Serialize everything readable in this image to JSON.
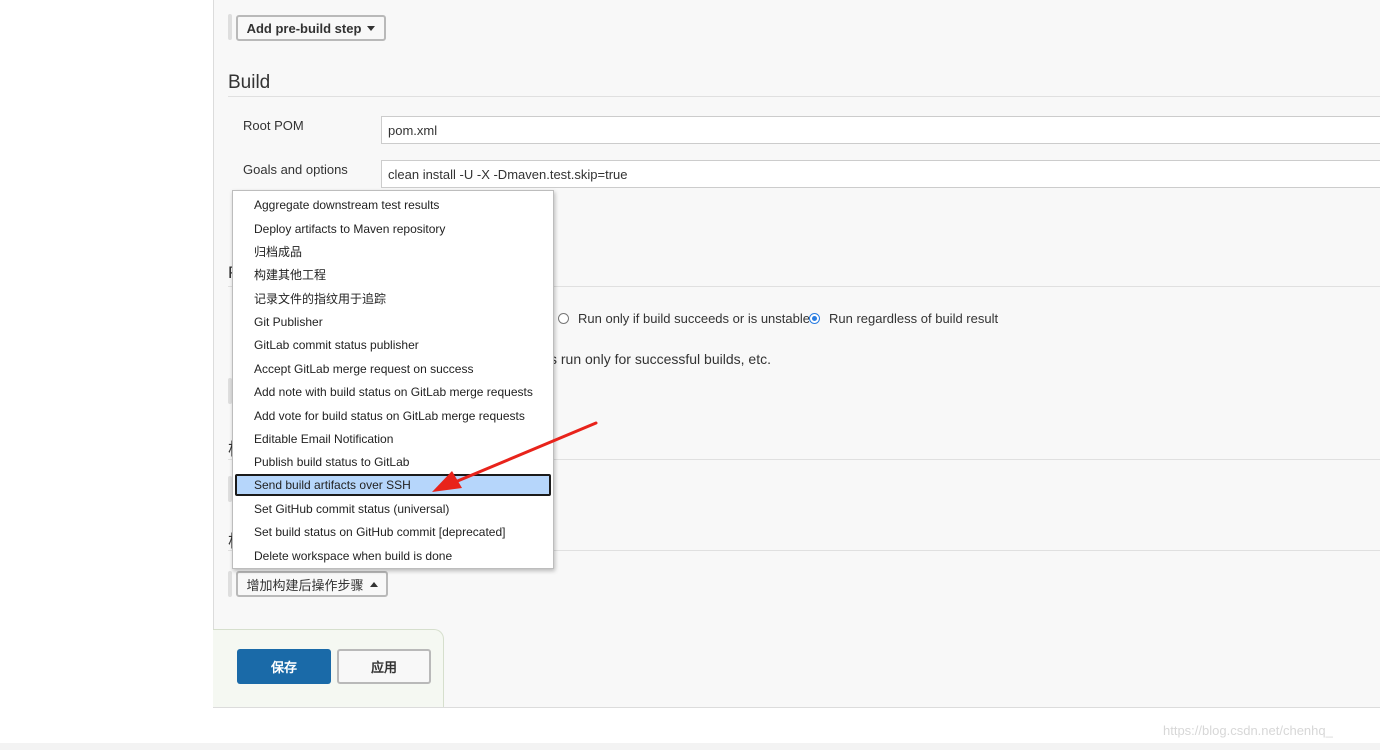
{
  "pre_build": {
    "add_button_label": "Add pre-build step"
  },
  "build": {
    "heading": "Build",
    "root_pom_label": "Root POM",
    "root_pom_value": "pom.xml",
    "goals_label": "Goals and options",
    "goals_value": "clean install -U -X -Dmaven.test.skip=true"
  },
  "post_steps": {
    "heading_fragment": "P",
    "radio_options": [
      {
        "label": "Run only if build succeeds or is unstable",
        "checked": false
      },
      {
        "label": "Run regardless of build result",
        "checked": true
      }
    ],
    "help_fragment": "s run only for successful builds, etc.",
    "section2_fragment": "构",
    "section3_fragment": "构"
  },
  "dropdown": {
    "items": [
      "Aggregate downstream test results",
      "Deploy artifacts to Maven repository",
      "归档成品",
      "构建其他工程",
      "记录文件的指纹用于追踪",
      "Git Publisher",
      "GitLab commit status publisher",
      "Accept GitLab merge request on success",
      "Add note with build status on GitLab merge requests",
      "Add vote for build status on GitLab merge requests",
      "Editable Email Notification",
      "Publish build status to GitLab",
      "Send build artifacts over SSH",
      "Set GitHub commit status (universal)",
      "Set build status on GitHub commit [deprecated]",
      "Delete workspace when build is done"
    ],
    "selected_item": "Send build artifacts over SSH"
  },
  "post_build": {
    "add_button_label": "增加构建后操作步骤"
  },
  "actions": {
    "save_label": "保存",
    "apply_label": "应用"
  },
  "watermark": "https://blog.csdn.net/chenhq_",
  "colors": {
    "primary": "#1a6aa8",
    "selection": "#b6d6fb",
    "annotation_arrow": "#e8231b"
  }
}
